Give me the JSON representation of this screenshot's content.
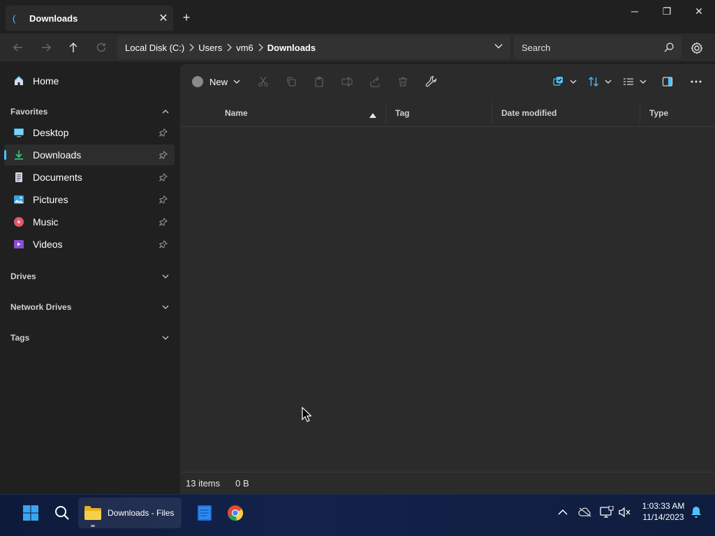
{
  "tab": {
    "title": "Downloads",
    "close": "✕",
    "new": "+"
  },
  "window": {
    "minimize": "─",
    "maximize": "❐",
    "close": "✕"
  },
  "breadcrumb": [
    "Local Disk (C:)",
    "Users",
    "vm6",
    "Downloads"
  ],
  "search": {
    "placeholder": "Search"
  },
  "sidebar": {
    "home": "Home",
    "favorites_title": "Favorites",
    "favorites": [
      {
        "label": "Desktop",
        "icon": "desktop-icon"
      },
      {
        "label": "Downloads",
        "icon": "download-icon",
        "selected": true
      },
      {
        "label": "Documents",
        "icon": "document-icon"
      },
      {
        "label": "Pictures",
        "icon": "pictures-icon"
      },
      {
        "label": "Music",
        "icon": "music-icon"
      },
      {
        "label": "Videos",
        "icon": "videos-icon"
      }
    ],
    "sections": [
      "Drives",
      "Network Drives",
      "Tags"
    ]
  },
  "toolbar": {
    "new_label": "New"
  },
  "columns": [
    "Name",
    "Tag",
    "Date modified",
    "Type"
  ],
  "status": {
    "items": "13 items",
    "size": "0 B"
  },
  "taskbar": {
    "files_label": "Downloads - Files"
  },
  "clock": {
    "time": "1:03:33 AM",
    "date": "11/14/2023"
  },
  "colors": {
    "accent": "#4cc2ff",
    "background": "#202020",
    "surface": "#2b2b2b"
  }
}
